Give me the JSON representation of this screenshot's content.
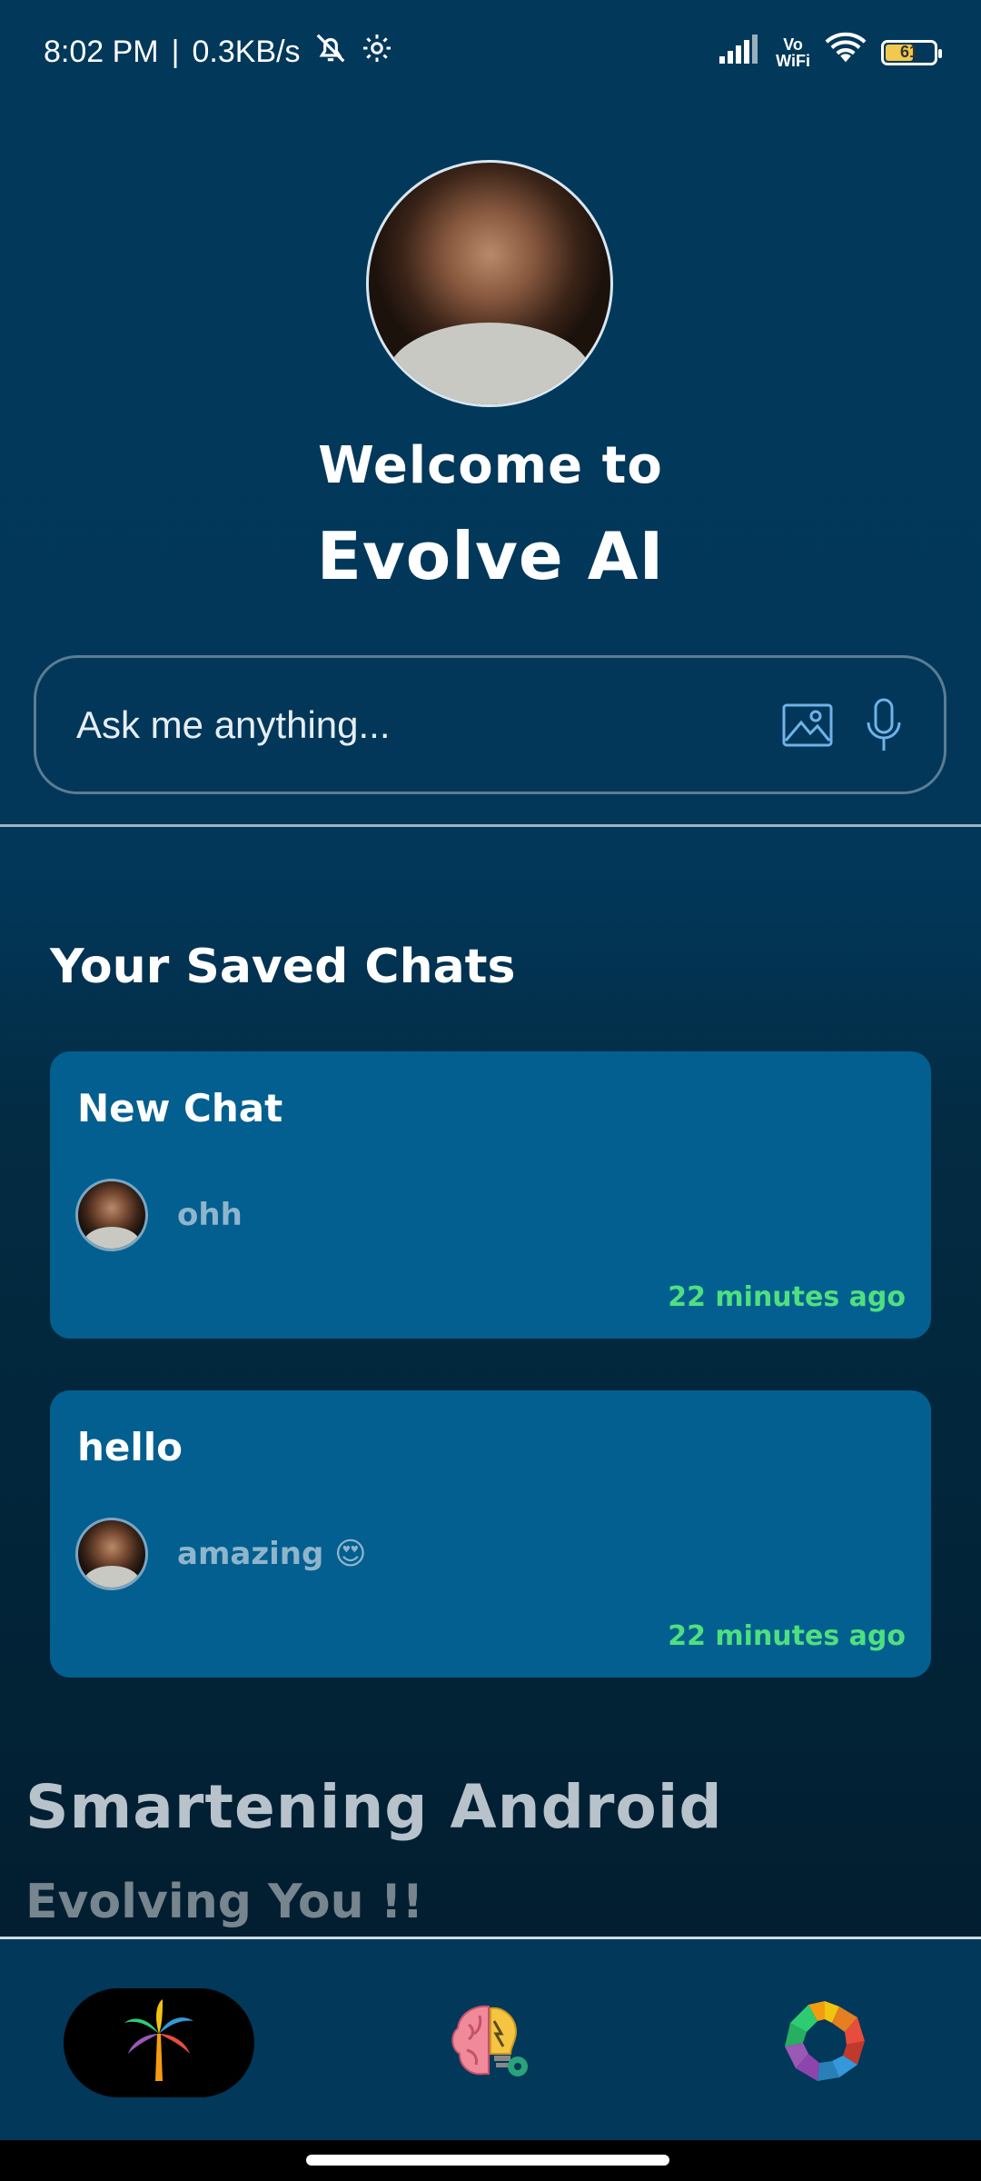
{
  "status_bar": {
    "time": "8:02 PM",
    "speed": "0.3KB/s",
    "vo": "Vo",
    "wifi_label": "WiFi",
    "battery_level": "61",
    "battery_fraction": 0.61,
    "icons": [
      "mute-bell-icon",
      "settings-gear-icon",
      "signal-icon",
      "wifi-icon",
      "battery-icon"
    ]
  },
  "header": {
    "welcome_line": "Welcome to",
    "app_name": "Evolve AI"
  },
  "ask": {
    "placeholder": "Ask me anything...",
    "icons": [
      "image-icon",
      "microphone-icon"
    ]
  },
  "saved": {
    "heading": "Your Saved Chats",
    "chats": [
      {
        "title": "New Chat",
        "preview": "ohh",
        "time": "22 minutes ago"
      },
      {
        "title": "hello",
        "preview": "amazing 😍",
        "time": "22 minutes ago"
      }
    ]
  },
  "footer": {
    "headline": "Smartening Android",
    "tagline": "Evolving You !!"
  },
  "bottom_nav": {
    "items": [
      "palm-tree-icon",
      "brain-gear-icon",
      "colorful-gear-icon"
    ],
    "active_index": 0
  },
  "colors": {
    "accent_green": "#4ee080",
    "card_blue": "#035f8f",
    "background_top": "#02385a",
    "icon_blue": "#6fb3e8"
  }
}
